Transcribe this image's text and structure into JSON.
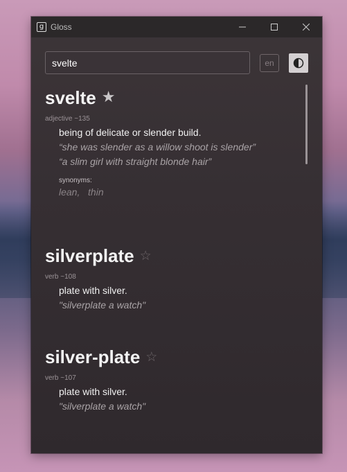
{
  "window": {
    "app_icon_letter": "g",
    "title": "Gloss",
    "minimize_icon": "—",
    "maximize_icon": "☐",
    "close_icon": "✕"
  },
  "toolbar": {
    "search_value": "svelte",
    "lang_label": "en",
    "theme_icon": "contrast-icon"
  },
  "entries": [
    {
      "word": "svelte",
      "favorited": true,
      "pos": "adjective ~135",
      "definition": "being of delicate or slender build.",
      "examples": [
        "“she was slender as a willow shoot is slender”",
        "“a slim girl with straight blonde hair”"
      ],
      "synonyms_label": "synonyms:",
      "synonyms": "lean,   thin"
    },
    {
      "word": "silverplate",
      "favorited": false,
      "pos": "verb ~108",
      "definition": "plate with silver.",
      "examples": [
        "\"silverplate a watch\""
      ]
    },
    {
      "word": "silver-plate",
      "favorited": false,
      "pos": "verb ~107",
      "definition": "plate with silver.",
      "examples": [
        "\"silverplate a watch\""
      ]
    }
  ],
  "colors": {
    "window_bg": "#362f33",
    "titlebar_bg": "#2b2829",
    "star_filled": "#c9c6c8",
    "star_empty": "#6d6669"
  }
}
